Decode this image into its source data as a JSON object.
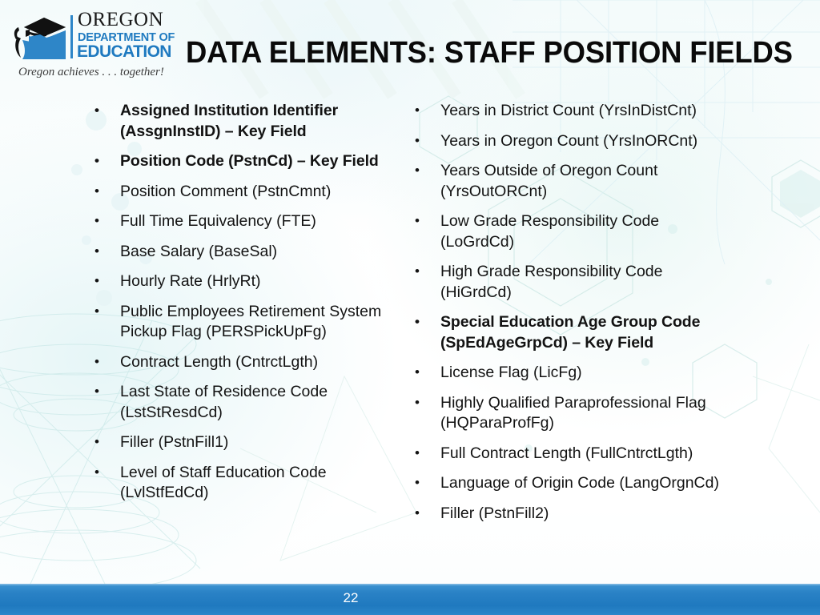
{
  "logo": {
    "mark_name": "oregon-state-graduation-cap-logo",
    "line1": "OREGON",
    "line2": "DEPARTMENT OF",
    "line3": "EDUCATION",
    "tagline": "Oregon achieves . . . together!",
    "accent_color": "#1f7ac0"
  },
  "header": {
    "title": "DATA ELEMENTS: STAFF POSITION FIELDS"
  },
  "columns": {
    "left": [
      {
        "text": "Assigned Institution Identifier (AssgnInstID) – Key Field",
        "bold": true
      },
      {
        "text": "Position Code (PstnCd) – Key Field",
        "bold": true
      },
      {
        "text": "Position Comment (PstnCmnt)",
        "bold": false
      },
      {
        "text": "Full Time Equivalency (FTE)",
        "bold": false
      },
      {
        "text": "Base Salary (BaseSal)",
        "bold": false
      },
      {
        "text": "Hourly Rate (HrlyRt)",
        "bold": false
      },
      {
        "text": "Public Employees Retirement System Pickup Flag (PERSPickUpFg)",
        "bold": false
      },
      {
        "text": "Contract Length (CntrctLgth)",
        "bold": false
      },
      {
        "text": "Last State of Residence Code (LstStResdCd)",
        "bold": false
      },
      {
        "text": "Filler (PstnFill1)",
        "bold": false
      },
      {
        "text": "Level of Staff Education Code (LvlStfEdCd)",
        "bold": false
      }
    ],
    "right": [
      {
        "text": "Years in District Count (YrsInDistCnt)",
        "bold": false
      },
      {
        "text": "Years in Oregon Count (YrsInORCnt)",
        "bold": false
      },
      {
        "text": "Years Outside of Oregon Count (YrsOutORCnt)",
        "bold": false
      },
      {
        "text": "Low Grade Responsibility Code (LoGrdCd)",
        "bold": false
      },
      {
        "text": "High Grade Responsibility Code (HiGrdCd)",
        "bold": false
      },
      {
        "text": "Special Education Age Group Code (SpEdAgeGrpCd) – Key Field",
        "bold": true
      },
      {
        "text": "License Flag (LicFg)",
        "bold": false
      },
      {
        "text": "Highly Qualified Paraprofessional Flag (HQParaProfFg)",
        "bold": false
      },
      {
        "text": "Full Contract Length (FullCntrctLgth)",
        "bold": false
      },
      {
        "text": "Language of Origin Code (LangOrgnCd)",
        "bold": false
      },
      {
        "text": "Filler (PstnFill2)",
        "bold": false
      }
    ]
  },
  "footer": {
    "page_number": "22",
    "bar_color": "#2480c6"
  }
}
